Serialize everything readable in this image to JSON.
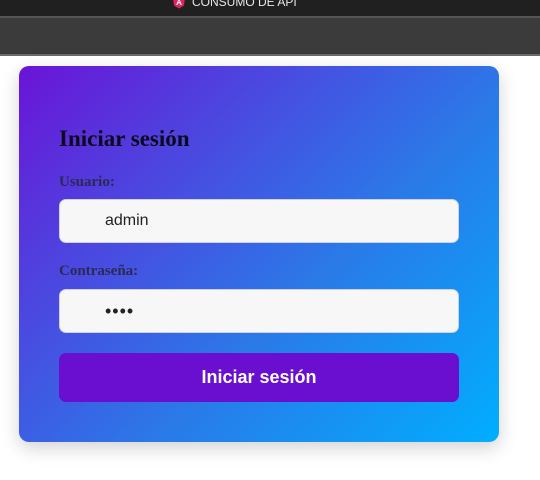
{
  "browser": {
    "tab_title": "CONSUMO DE API",
    "tab_icon": "angular-logo-icon",
    "tab_icon_color": "#e0245e"
  },
  "login": {
    "title": "Iniciar sesión",
    "username_label": "Usuario:",
    "username_value": "admin",
    "password_label": "Contraseña:",
    "password_value": "1234",
    "submit_label": "Iniciar sesión"
  },
  "colors": {
    "gradient_start": "#6a14d6",
    "gradient_end": "#00aeff",
    "button": "#6a0fd0",
    "field_bg": "#f7f7f7"
  }
}
